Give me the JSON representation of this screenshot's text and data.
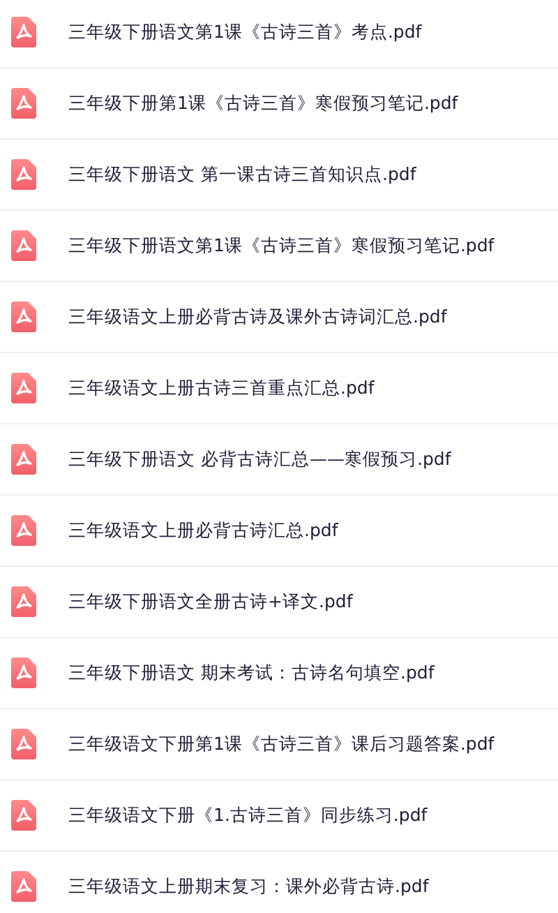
{
  "files": [
    {
      "name": "三年级下册语文第1课《古诗三首》考点.pdf"
    },
    {
      "name": "三年级下册第1课《古诗三首》寒假预习笔记.pdf"
    },
    {
      "name": "三年级下册语文 第一课古诗三首知识点.pdf"
    },
    {
      "name": "三年级下册语文第1课《古诗三首》寒假预习笔记.pdf"
    },
    {
      "name": "三年级语文上册必背古诗及课外古诗词汇总.pdf"
    },
    {
      "name": "三年级语文上册古诗三首重点汇总.pdf"
    },
    {
      "name": "三年级下册语文 必背古诗汇总——寒假预习.pdf"
    },
    {
      "name": "三年级语文上册必背古诗汇总.pdf"
    },
    {
      "name": "三年级下册语文全册古诗+译文.pdf"
    },
    {
      "name": "三年级下册语文 期末考试：古诗名句填空.pdf"
    },
    {
      "name": "三年级语文下册第1课《古诗三首》课后习题答案.pdf"
    },
    {
      "name": "三年级语文下册《1.古诗三首》同步练习.pdf"
    },
    {
      "name": "三年级语文上册期末复习：课外必背古诗.pdf"
    }
  ]
}
